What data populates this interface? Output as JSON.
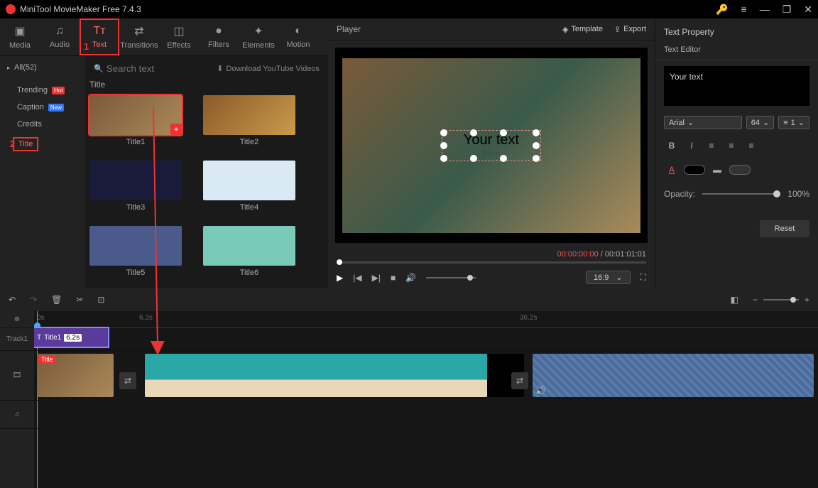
{
  "app": {
    "title": "MiniTool MovieMaker Free 7.4.3"
  },
  "toolbar": {
    "media": "Media",
    "audio": "Audio",
    "text": "Text",
    "transitions": "Transitions",
    "effects": "Effects",
    "filters": "Filters",
    "elements": "Elements",
    "motion": "Motion"
  },
  "sidebar": {
    "all": "All(52)",
    "trending": "Trending",
    "caption": "Caption",
    "credits": "Credits",
    "title": "Title",
    "hot_badge": "Hot",
    "new_badge": "New"
  },
  "search": {
    "placeholder": "Search text",
    "download": "Download YouTube Videos"
  },
  "grid": {
    "section": "Title",
    "items": [
      "Title1",
      "Title2",
      "Title3",
      "Title4",
      "Title5",
      "Title6"
    ]
  },
  "player": {
    "title": "Player",
    "template": "Template",
    "export": "Export",
    "text": "Your text",
    "subtext": "here",
    "current": "00:00:00:00",
    "total": "00:01:01:01",
    "aspect": "16:9"
  },
  "props": {
    "title": "Text Property",
    "editor_label": "Text Editor",
    "text_value": "Your text",
    "font": "Arial",
    "size": "64",
    "spacing": "1",
    "opacity_label": "Opacity:",
    "opacity_value": "100%",
    "reset": "Reset"
  },
  "timeline": {
    "ticks": [
      "0s",
      "6.2s",
      "36.2s"
    ],
    "track1": "Track1",
    "title_clip": {
      "label": "Title1",
      "duration": "6.2s"
    },
    "title_tag": "Title"
  },
  "annotations": {
    "one": "1",
    "two": "2"
  }
}
